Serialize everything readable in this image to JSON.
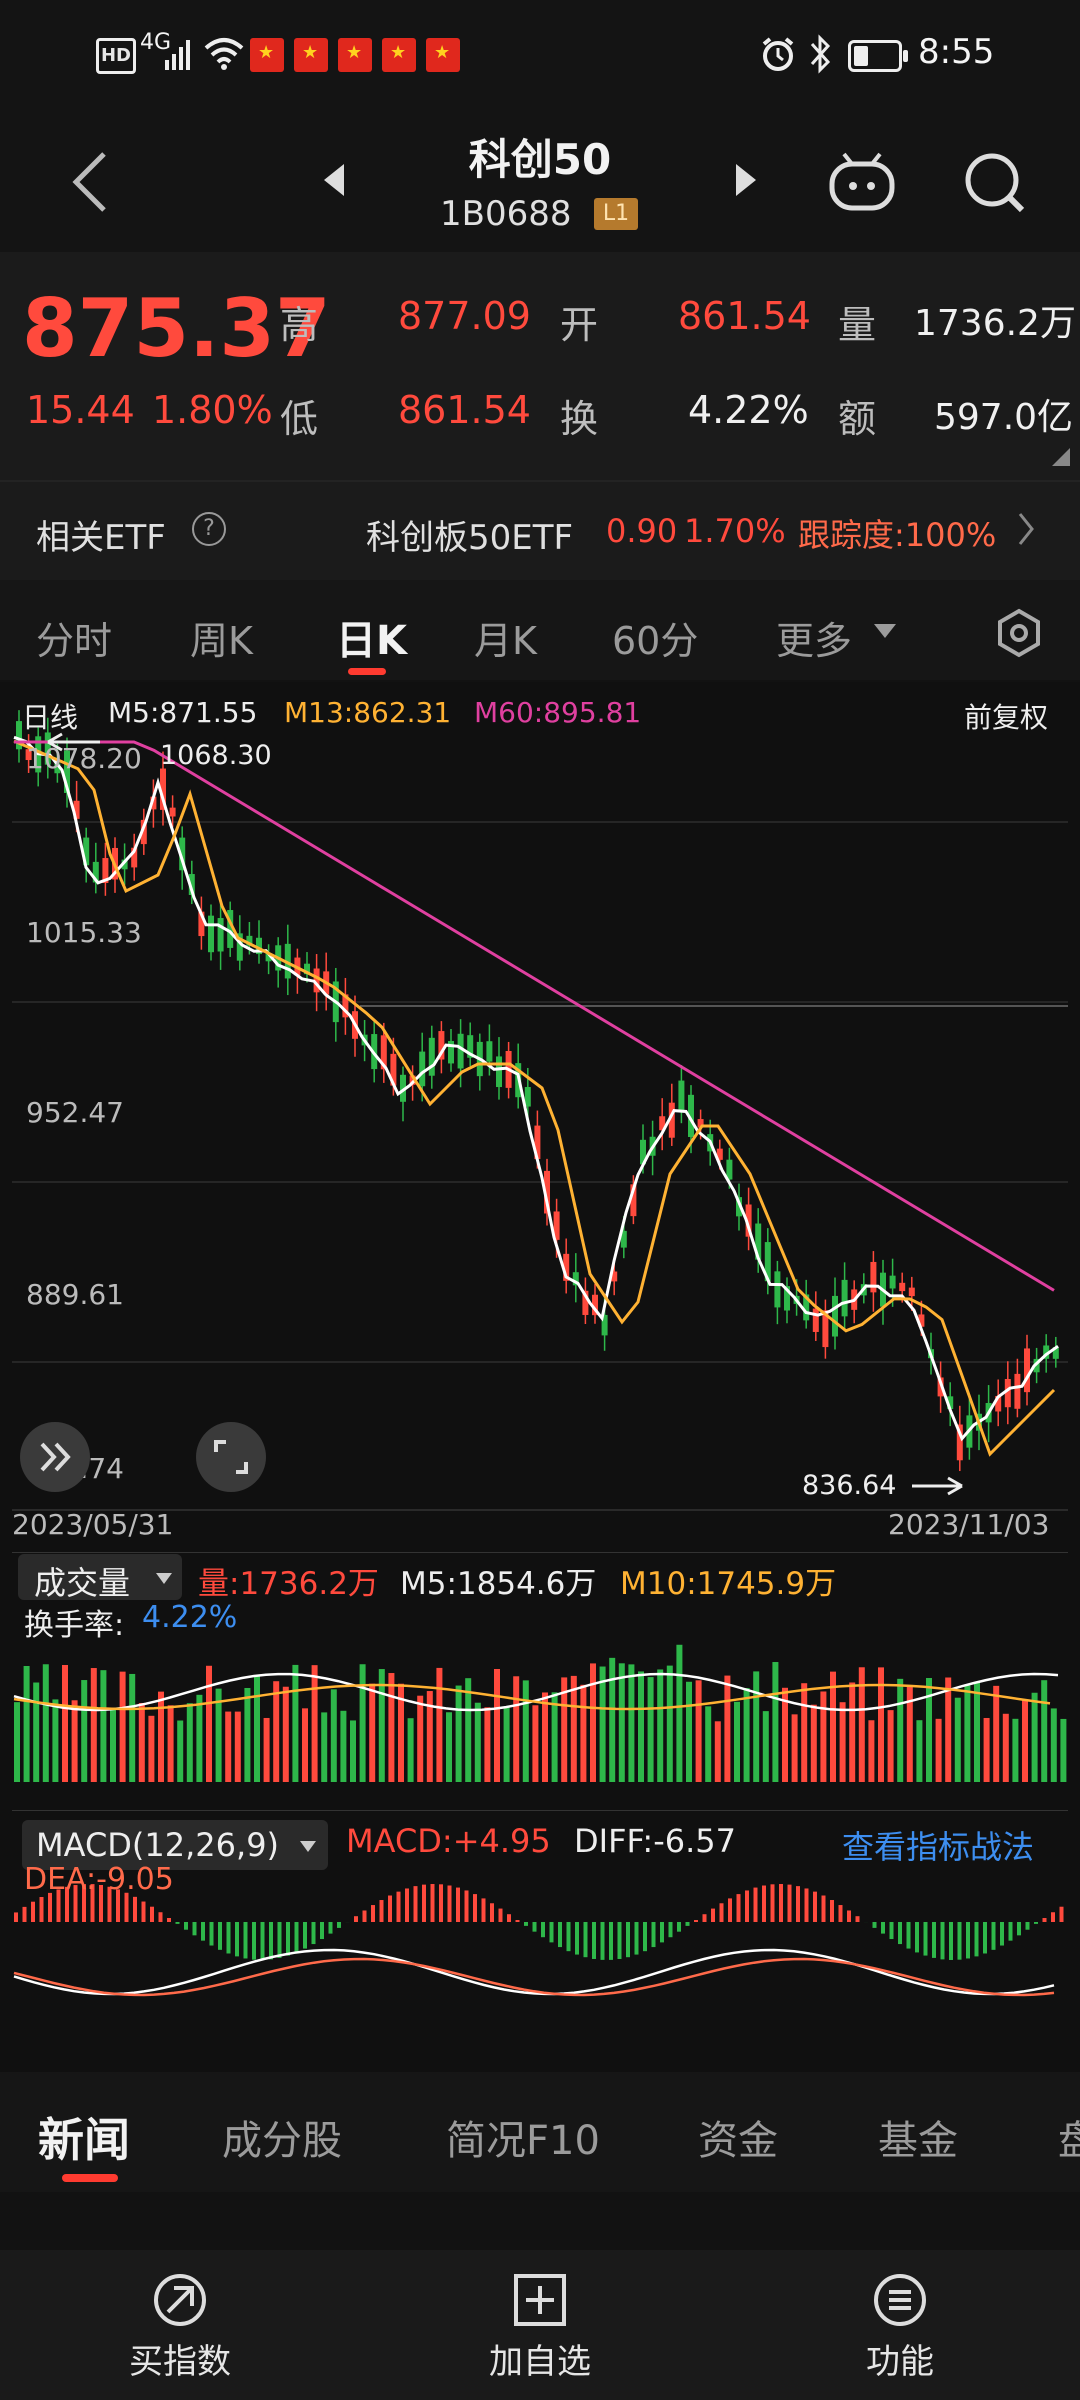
{
  "status_bar": {
    "network": "4G",
    "time": "8:55"
  },
  "header": {
    "title": "科创50",
    "code": "1B0688",
    "level": "L1"
  },
  "quote": {
    "price": "875.37",
    "change": "15.44",
    "change_pct": "1.80%",
    "high_label": "高",
    "high": "877.09",
    "open_label": "开",
    "open": "861.54",
    "volume_label": "量",
    "volume": "1736.2万",
    "low_label": "低",
    "low": "861.54",
    "turnover_label": "换",
    "turnover": "4.22%",
    "amount_label": "额",
    "amount": "597.0亿"
  },
  "etf": {
    "label": "相关ETF",
    "name": "科创板50ETF",
    "price": "0.90",
    "pct": "1.70%",
    "tracking": "跟踪度:100%"
  },
  "tabs": [
    "分时",
    "周K",
    "日K",
    "月K",
    "60分",
    "更多"
  ],
  "chart": {
    "period": "日线",
    "ma5": "M5:871.55",
    "ma13": "M13:862.31",
    "ma60": "M60:895.81",
    "adjust": "前复权",
    "high_mark": "1068.30",
    "low_mark": "836.64",
    "y_labels": [
      "1078.20",
      "1015.33",
      "952.47",
      "889.61",
      "826.74"
    ],
    "start_date": "2023/05/31",
    "end_date": "2023/11/03"
  },
  "volume_panel": {
    "name": "成交量",
    "vol": "量:1736.2万",
    "m5": "M5:1854.6万",
    "m10": "M10:1745.9万",
    "turnover": "换手率:",
    "turnover_val": "4.22%"
  },
  "macd_panel": {
    "name": "MACD(12,26,9)",
    "macd": "MACD:+4.95",
    "diff": "DIFF:-6.57",
    "dea": "DEA:-9.05",
    "link": "查看指标战法"
  },
  "bottom_tabs": [
    "新闻",
    "成分股",
    "简况F10",
    "资金",
    "基金",
    "盘"
  ],
  "footer": {
    "buy": "买指数",
    "add": "加自选",
    "func": "功能"
  },
  "colors": {
    "up": "#ff4a3d",
    "down": "#2eb84a",
    "ma5": "#ffffff",
    "ma13": "#ffb233",
    "ma60": "#e040a0",
    "accent": "#ff3b30",
    "link": "#3d8ef0"
  }
}
